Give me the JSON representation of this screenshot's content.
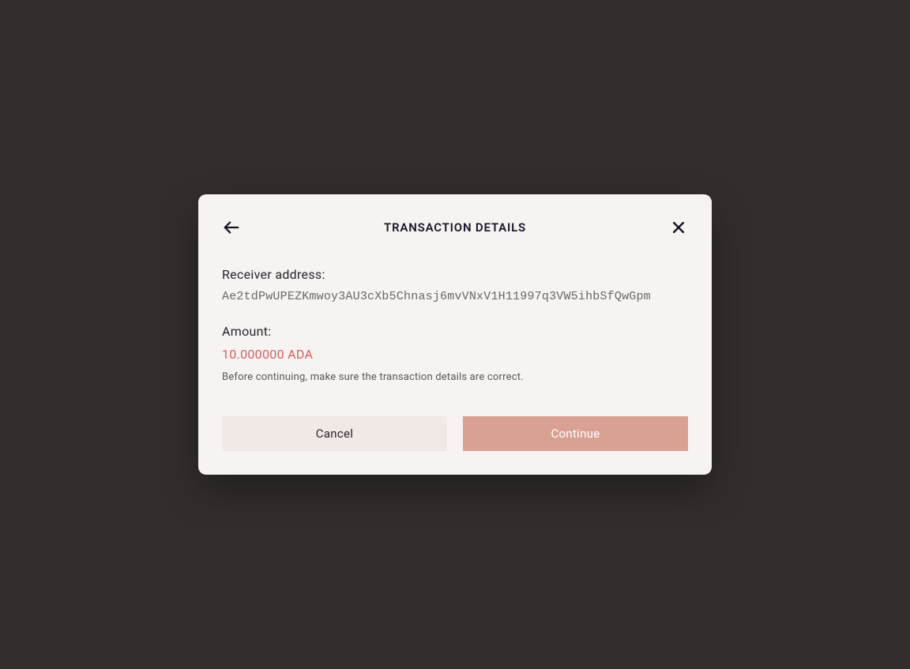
{
  "modal": {
    "title": "TRANSACTION DETAILS",
    "receiver_label": "Receiver address:",
    "receiver_address": "Ae2tdPwUPEZKmwoy3AU3cXb5Chnasj6mvVNxV1H11997q3VW5ihbSfQwGpm",
    "amount_label": "Amount:",
    "amount_value": "10.000000 ADA",
    "warning_text": "Before continuing, make sure the transaction details are correct.",
    "cancel_label": "Cancel",
    "continue_label": "Continue"
  }
}
